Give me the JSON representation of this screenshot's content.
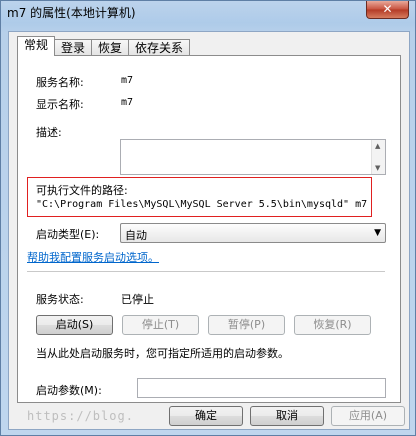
{
  "window": {
    "title": "m7 的属性(本地计算机)",
    "close_label": "✕"
  },
  "tabs": [
    {
      "label": "常规",
      "active": true
    },
    {
      "label": "登录",
      "active": false
    },
    {
      "label": "恢复",
      "active": false
    },
    {
      "label": "依存关系",
      "active": false
    }
  ],
  "general": {
    "service_name_label": "服务名称:",
    "service_name_value": "m7",
    "display_name_label": "显示名称:",
    "display_name_value": "m7",
    "description_label": "描述:",
    "description_value": "",
    "exe_path_label": "可执行文件的路径:",
    "exe_path_value": "\"C:\\Program Files\\MySQL\\MySQL Server 5.5\\bin\\mysqld\" m7",
    "startup_type_label": "启动类型(E):",
    "startup_type_value": "自动",
    "help_link": "帮助我配置服务启动选项。",
    "status_label": "服务状态:",
    "status_value": "已停止",
    "buttons": {
      "start": "启动(S)",
      "stop": "停止(T)",
      "pause": "暂停(P)",
      "resume": "恢复(R)"
    },
    "hint": "当从此处启动服务时，您可指定所适用的启动参数。",
    "params_label": "启动参数(M):",
    "params_value": ""
  },
  "footer": {
    "ok": "确定",
    "cancel": "取消",
    "apply": "应用(A)"
  },
  "watermark": "https://blog."
}
